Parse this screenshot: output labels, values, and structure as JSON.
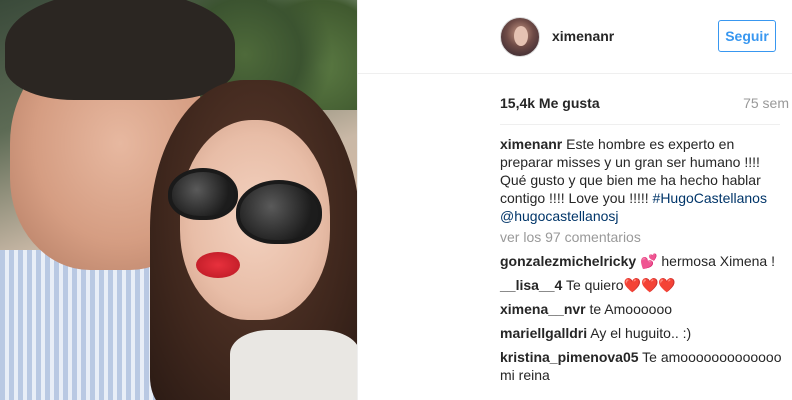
{
  "post": {
    "username": "ximenanr",
    "follow_label": "Seguir",
    "likes": "15,4k Me gusta",
    "time_ago": "75 sem",
    "caption": {
      "username": "ximenanr",
      "text": "Este hombre es experto en preparar misses y un gran ser humano !!!! Qué gusto y que bien me ha hecho hablar contigo !!!! Love you !!!!!",
      "hashtag": "#HugoCastellanos",
      "mention": "@hugocastellanosj"
    },
    "view_comments": "ver los 97 comentarios",
    "comments": [
      {
        "username": "gonzalezmichelricky",
        "text": "💕 hermosa Ximena !"
      },
      {
        "username": "__lisa__4",
        "text": "Te quiero❤️❤️❤️"
      },
      {
        "username": "ximena__nvr",
        "text": "te Amoooooo"
      },
      {
        "username": "mariellgalldri",
        "text": "Ay el huguito.. :)"
      },
      {
        "username": "kristina_pimenova05",
        "text": "Te amooooooooooooo mi reina"
      }
    ]
  }
}
